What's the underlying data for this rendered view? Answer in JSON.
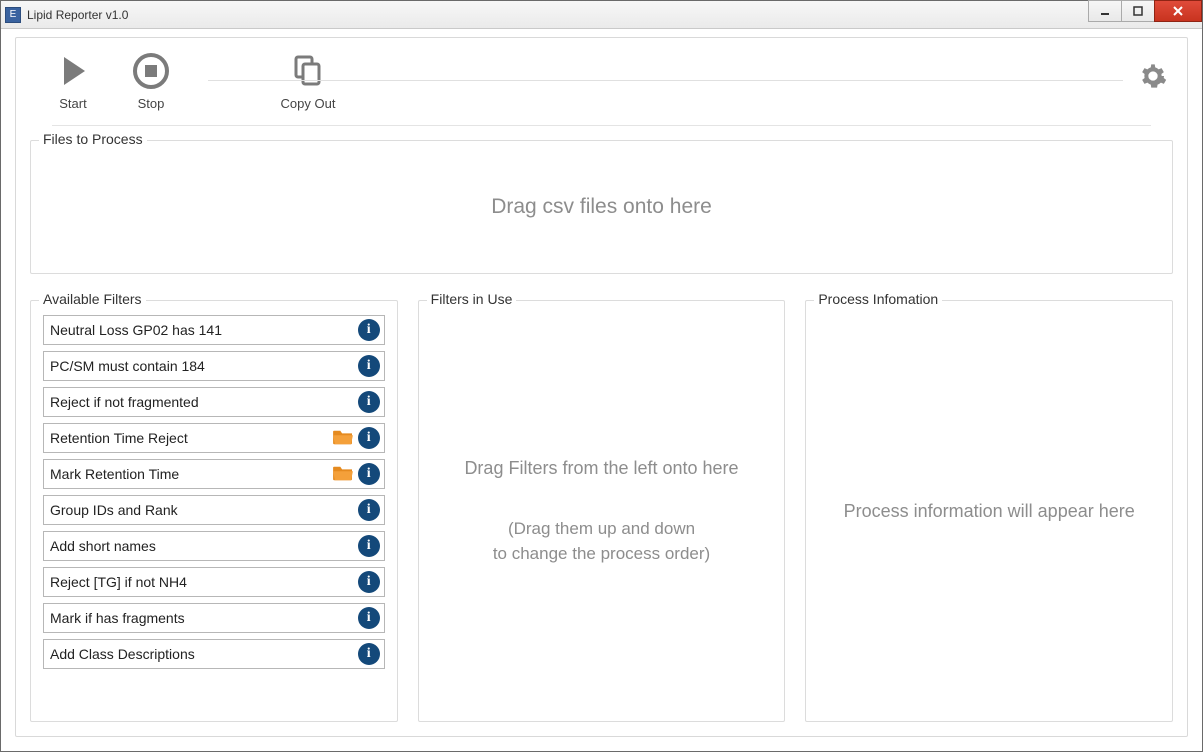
{
  "window": {
    "title": "Lipid Reporter v1.0"
  },
  "toolbar": {
    "start_label": "Start",
    "stop_label": "Stop",
    "copy_out_label": "Copy Out"
  },
  "sections": {
    "files_legend": "Files to Process",
    "files_placeholder": "Drag csv files onto here",
    "available_legend": "Available Filters",
    "inuse_legend": "Filters in Use",
    "inuse_placeholder_1": "Drag Filters from the left onto here",
    "inuse_placeholder_2": "(Drag them up and down\nto change the process order)",
    "process_legend": "Process Infomation",
    "process_placeholder": "Process information will appear here"
  },
  "available_filters": [
    {
      "label": "Neutral Loss GP02 has 141",
      "has_folder": false
    },
    {
      "label": "PC/SM must contain 184",
      "has_folder": false
    },
    {
      "label": "Reject if not fragmented",
      "has_folder": false
    },
    {
      "label": "Retention Time Reject",
      "has_folder": true
    },
    {
      "label": "Mark Retention Time",
      "has_folder": true
    },
    {
      "label": "Group IDs and Rank",
      "has_folder": false
    },
    {
      "label": "Add short names",
      "has_folder": false
    },
    {
      "label": "Reject [TG] if not NH4",
      "has_folder": false
    },
    {
      "label": "Mark if has fragments",
      "has_folder": false
    },
    {
      "label": "Add Class Descriptions",
      "has_folder": false
    }
  ]
}
